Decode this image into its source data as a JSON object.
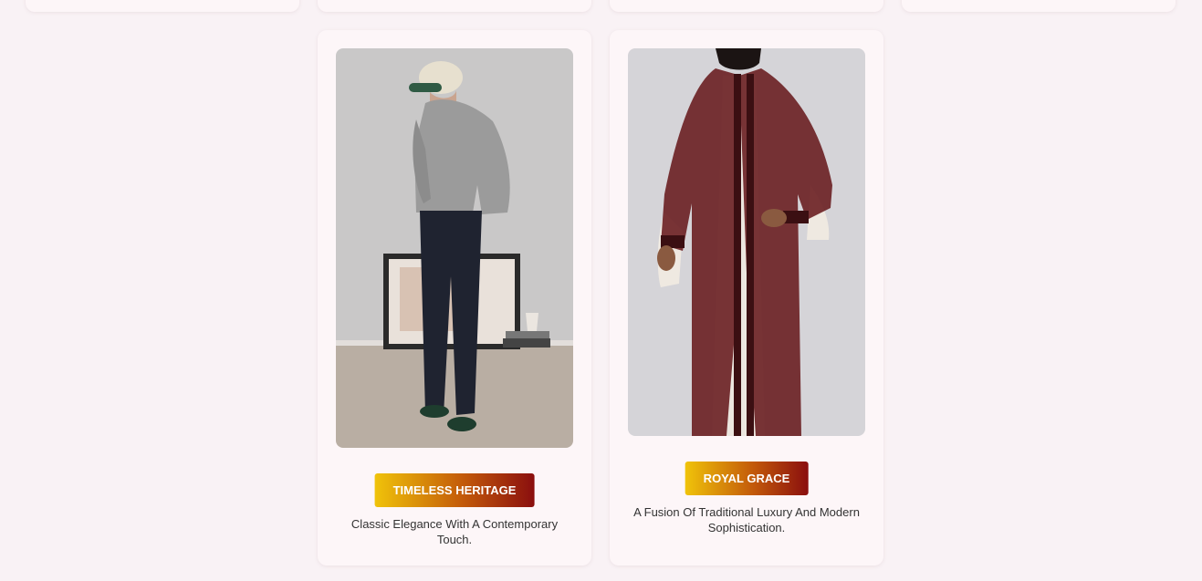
{
  "products": [
    {
      "title": "TIMELESS HERITAGE",
      "description": "Classic Elegance With A Contemporary Touch.",
      "image_alt": "Man in grey sweater, cap and navy trousers"
    },
    {
      "title": "ROYAL GRACE",
      "description": "A Fusion Of Traditional Luxury And Modern Sophistication.",
      "image_alt": "Man in maroon sheer embroidered kaftan over white robe"
    }
  ],
  "colors": {
    "page_bg": "#f9f2f5",
    "card_bg": "#fdf6f8",
    "badge_gradient": [
      "#f0c30a",
      "#c35a0a",
      "#8a0e0e"
    ]
  }
}
